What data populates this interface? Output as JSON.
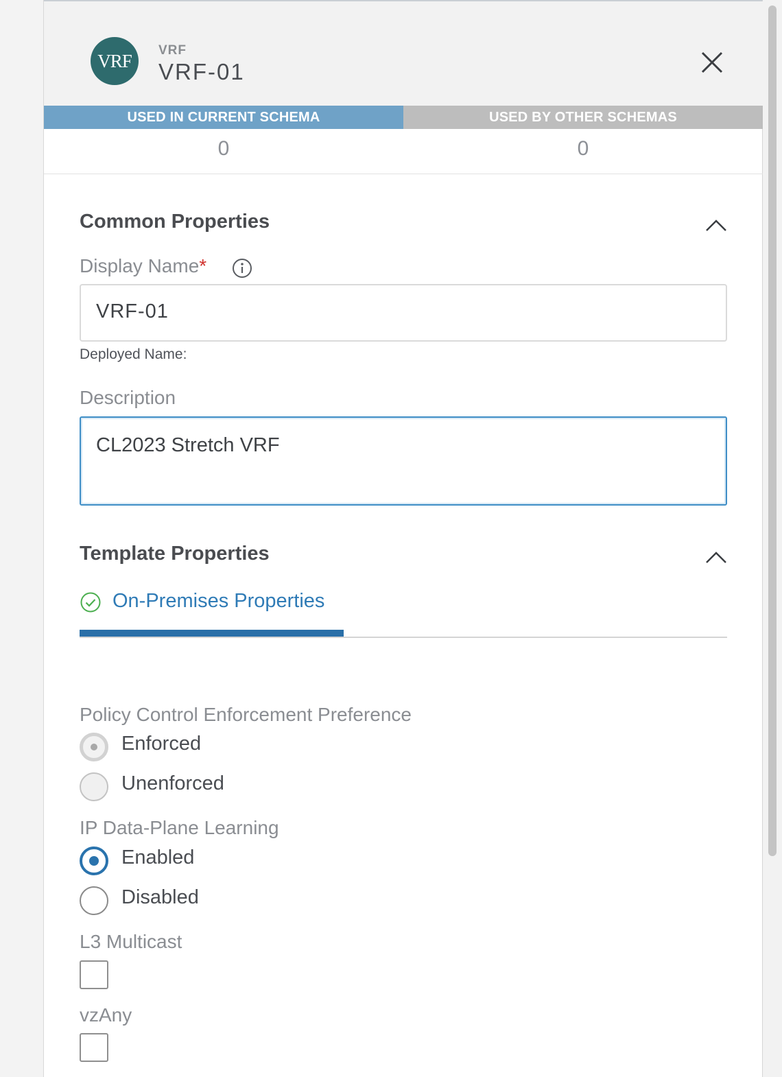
{
  "header": {
    "avatar_text": "VRF",
    "object_type": "VRF",
    "object_name": "VRF-01",
    "close_icon": "close-icon"
  },
  "usage": {
    "current_label": "USED IN CURRENT SCHEMA",
    "current_count": "0",
    "other_label": "USED BY OTHER SCHEMAS",
    "other_count": "0"
  },
  "common": {
    "title": "Common Properties",
    "display_name_label": "Display Name",
    "required_mark": "*",
    "display_name_value": "VRF-01",
    "deployed_name_label": "Deployed Name:",
    "description_label": "Description",
    "description_value": "CL2023 Stretch VRF"
  },
  "template": {
    "title": "Template Properties",
    "tab_label": "On-Premises Properties",
    "policy": {
      "label": "Policy Control Enforcement Preference",
      "options": [
        "Enforced",
        "Unenforced"
      ],
      "selected": "Enforced"
    },
    "ip_learning": {
      "label": "IP Data-Plane Learning",
      "options": [
        "Enabled",
        "Disabled"
      ],
      "selected": "Enabled"
    },
    "l3_multicast": {
      "label": "L3 Multicast",
      "checked": false
    },
    "vzany": {
      "label": "vzAny",
      "checked": false
    }
  },
  "colors": {
    "accent": "#2a73ad",
    "avatar": "#2e6b6d",
    "tab_current": "#6fa2c7",
    "tab_other": "#bdbdbd",
    "required": "#d0312d",
    "success": "#4caf50"
  }
}
